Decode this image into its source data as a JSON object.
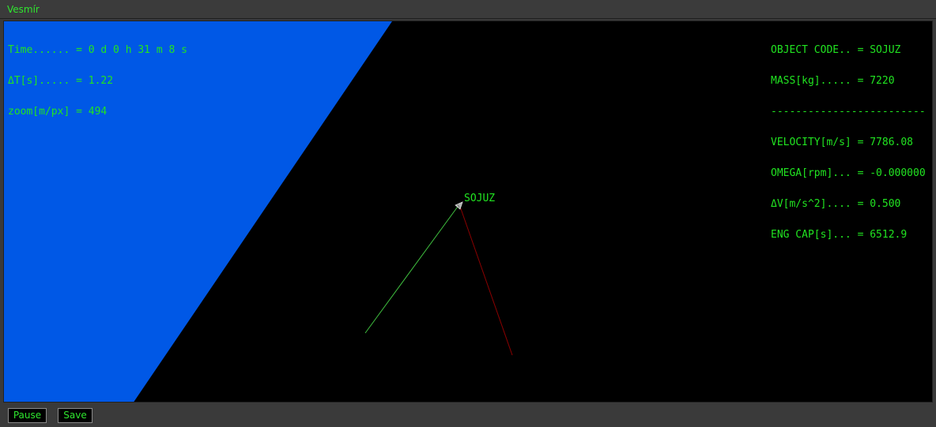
{
  "window": {
    "title": "Vesmír"
  },
  "hud_left": {
    "time": "Time...... = 0 d 0 h 31 m 8 s",
    "delta_t": "ΔT[s]..... = 1.22",
    "zoom": "zoom[m/px] = 494"
  },
  "hud_right": {
    "object_code": "OBJECT CODE.. = SOJUZ",
    "mass": "MASS[kg]..... = 7220",
    "separator": "-------------------------",
    "velocity": "VELOCITY[m/s] = 7786.08",
    "omega": "OMEGA[rpm]... = -0.000000",
    "delta_v": "ΔV[m/s^2].... = 0.500",
    "eng_cap": "ENG CAP[s]... = 6512.9"
  },
  "ship": {
    "label": "SOJUZ"
  },
  "colors": {
    "hud_text": "#21e421",
    "planet": "#0058e6",
    "velocity_vector": "#3fbf3f",
    "gravity_vector": "#8b0000",
    "background": "#000000"
  },
  "toolbar": {
    "pause_label": "Pause",
    "save_label": "Save"
  }
}
